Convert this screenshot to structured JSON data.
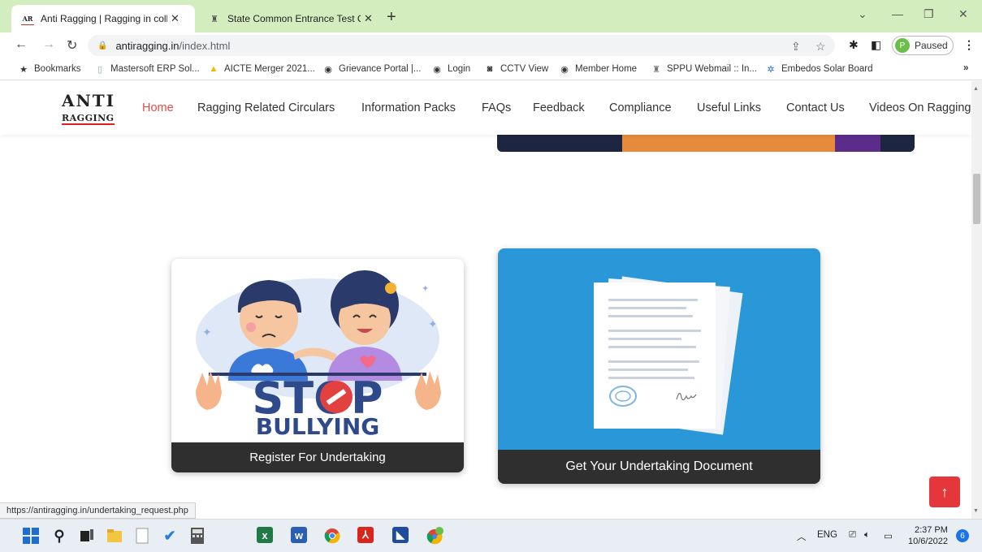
{
  "browser": {
    "tabs": [
      {
        "title": "Anti Ragging | Ragging in college",
        "active": true
      },
      {
        "title": "State Common Entrance Test Cell",
        "active": false
      }
    ],
    "address": {
      "host": "antiragging.in",
      "path": "/index.html"
    },
    "profile_label": "Paused",
    "profile_initial": "P",
    "bookmarks": [
      "Bookmarks",
      "Mastersoft ERP Sol...",
      "AICTE Merger 2021...",
      "Grievance Portal |...",
      "Login",
      "CCTV View",
      "Member Home",
      "SPPU Webmail :: In...",
      "Embedos Solar Board"
    ],
    "overflow_glyph": "»"
  },
  "site": {
    "logo_top": "ANTI",
    "logo_bottom": "RAGGING",
    "nav": [
      "Home",
      "Ragging Related Circulars",
      "Information Packs",
      "FAQs",
      "Feedback",
      "Compliance",
      "Useful Links",
      "Contact Us",
      "Videos On Ragging"
    ],
    "cards": {
      "register": {
        "caption": "Register For Undertaking",
        "art_line1": "STOP",
        "art_line2": "BULLYING"
      },
      "document": {
        "caption": "Get Your Undertaking Document"
      }
    },
    "scroll_top_glyph": "↑"
  },
  "status_url": "https://antiragging.in/undertaking_request.php",
  "taskbar": {
    "tray": {
      "language": "ENG",
      "time": "2:37 PM",
      "date": "10/6/2022",
      "notifications": "6"
    }
  },
  "colors": {
    "tabbar": "#d4edbf",
    "nav_active": "#e34b4b",
    "card_blue": "#2a97d9",
    "caption_bg": "#2f2f2f",
    "scroll_top_bg": "#e5363b"
  }
}
